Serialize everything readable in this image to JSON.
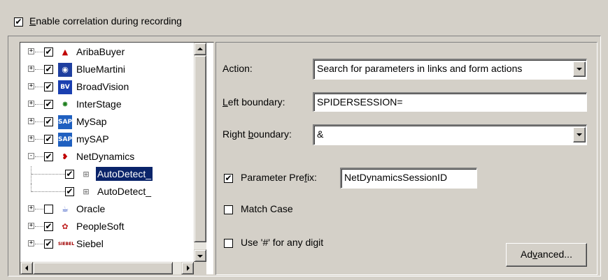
{
  "colors": {
    "dialog_bg": "#d4d0c8",
    "selection_bg": "#0a246a",
    "selection_fg": "#ffffff"
  },
  "enable": {
    "checked": true,
    "label_mnemonic": "E",
    "label_rest": "nable correlation during recording"
  },
  "tree": {
    "items": [
      {
        "label": "AribaBuyer",
        "icon": "ariba-icon",
        "checked": true,
        "expander": "+"
      },
      {
        "label": "BlueMartini",
        "icon": "bluemartini-icon",
        "checked": true,
        "expander": "+"
      },
      {
        "label": "BroadVision",
        "icon": "broadvision-icon",
        "checked": true,
        "expander": "+"
      },
      {
        "label": "InterStage",
        "icon": "interstage-icon",
        "checked": true,
        "expander": "+"
      },
      {
        "label": "MySap",
        "icon": "sap-icon",
        "checked": true,
        "expander": "+"
      },
      {
        "label": "mySAP",
        "icon": "sap-icon",
        "checked": true,
        "expander": "+"
      },
      {
        "label": "NetDynamics",
        "icon": "netdynamics-icon",
        "checked": true,
        "expander": "-"
      },
      {
        "label": "AutoDetect_",
        "icon": "rule-icon",
        "checked": true,
        "child": true,
        "selected": true
      },
      {
        "label": "AutoDetect_",
        "icon": "rule-icon",
        "checked": true,
        "child": true
      },
      {
        "label": "Oracle",
        "icon": "oracle-icon",
        "checked": false,
        "expander": "+"
      },
      {
        "label": "PeopleSoft",
        "icon": "peoplesoft-icon",
        "checked": true,
        "expander": "+"
      },
      {
        "label": "Siebel",
        "icon": "siebel-icon",
        "checked": true,
        "expander": "+"
      }
    ],
    "icon_text": {
      "broadvision": "BV",
      "sap": "SAP",
      "siebel": "SIEBEL"
    }
  },
  "form": {
    "action_label": "Action:",
    "action_value": "Search for parameters in links and form actions",
    "left_label_mn": "L",
    "left_label_rest": "eft boundary:",
    "left_value": "SPIDERSESSION=",
    "right_label_pre": "Right ",
    "right_label_mn": "b",
    "right_label_post": "oundary:",
    "right_value": "&",
    "prefix_checked": true,
    "prefix_label_pre": "Parameter Pre",
    "prefix_label_mn": "f",
    "prefix_label_post": "ix:",
    "prefix_value": "NetDynamicsSessionID",
    "match_case_checked": false,
    "match_case_label": "Match Case",
    "digit_checked": false,
    "digit_label": "Use '#' for any digit",
    "advanced_pre": "Ad",
    "advanced_mn": "v",
    "advanced_post": "anced..."
  }
}
